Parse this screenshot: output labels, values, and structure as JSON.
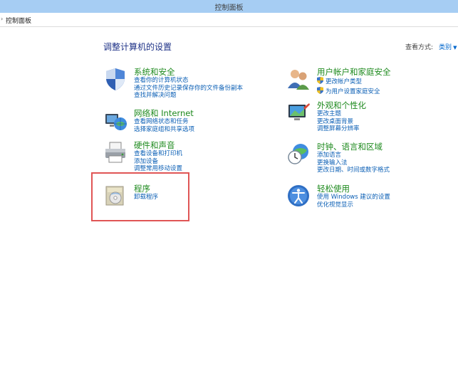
{
  "window": {
    "title": "控制面板"
  },
  "address": {
    "crumb": "控制面板"
  },
  "main": {
    "title": "调整计算机的设置",
    "view_by_label": "查看方式:",
    "view_by_value": "类别"
  },
  "categories_left": [
    {
      "head": "系统和安全",
      "links": [
        "查看你的计算机状态",
        "通过文件历史记录保存你的文件备份副本",
        "查找并解决问题"
      ]
    },
    {
      "head": "网络和 Internet",
      "links": [
        "查看网络状态和任务",
        "选择家庭组和共享选项"
      ]
    },
    {
      "head": "硬件和声音",
      "links": [
        "查看设备和打印机",
        "添加设备",
        "调整常用移动设置"
      ]
    },
    {
      "head": "程序",
      "links": [
        "卸载程序"
      ]
    }
  ],
  "categories_right": [
    {
      "head": "用户帐户和家庭安全",
      "links": [
        "更改帐户类型",
        "为用户设置家庭安全"
      ]
    },
    {
      "head": "外观和个性化",
      "links": [
        "更改主题",
        "更改桌面背景",
        "调整屏幕分辨率"
      ]
    },
    {
      "head": "时钟、语言和区域",
      "links": [
        "添加语言",
        "更换输入法",
        "更改日期、时间或数字格式"
      ]
    },
    {
      "head": "轻松使用",
      "links": [
        "使用 Windows 建议的设置",
        "优化视觉显示"
      ]
    }
  ],
  "colors": {
    "titlebar": "#a6cdf3",
    "heading_green": "#1e8a1e",
    "link_blue": "#0b5fb5",
    "highlight": "#e05555"
  }
}
